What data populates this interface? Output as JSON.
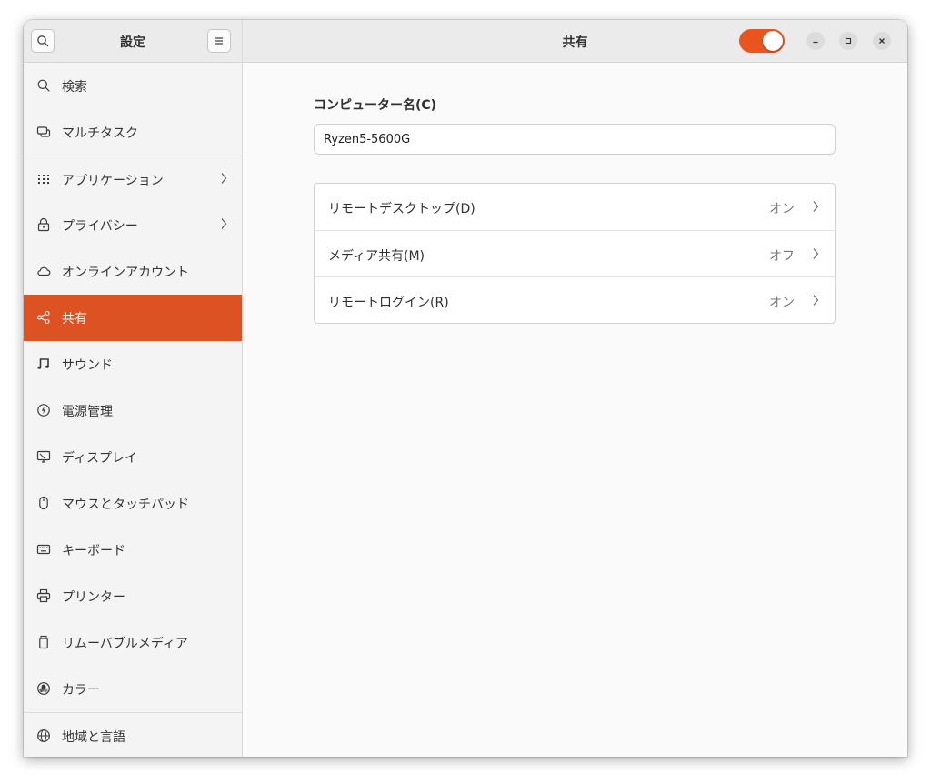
{
  "window": {
    "accent_color": "#e9541f"
  },
  "sidebar": {
    "title": "設定",
    "items": [
      {
        "label": "検索",
        "icon": "search-icon"
      },
      {
        "label": "マルチタスク",
        "icon": "multitasking-icon"
      },
      {
        "label": "アプリケーション",
        "icon": "apps-grid-icon"
      },
      {
        "label": "プライバシー",
        "icon": "lock-icon"
      },
      {
        "label": "オンラインアカウント",
        "icon": "cloud-icon"
      },
      {
        "label": "共有",
        "icon": "share-icon"
      },
      {
        "label": "サウンド",
        "icon": "music-note-icon"
      },
      {
        "label": "電源管理",
        "icon": "power-icon"
      },
      {
        "label": "ディスプレイ",
        "icon": "display-icon"
      },
      {
        "label": "マウスとタッチパッド",
        "icon": "mouse-icon"
      },
      {
        "label": "キーボード",
        "icon": "keyboard-icon"
      },
      {
        "label": "プリンター",
        "icon": "printer-icon"
      },
      {
        "label": "リムーバブルメディア",
        "icon": "removable-media-icon"
      },
      {
        "label": "カラー",
        "icon": "color-icon"
      },
      {
        "label": "地域と言語",
        "icon": "globe-icon"
      }
    ],
    "active_index": 5
  },
  "main": {
    "title": "共有",
    "sharing_enabled": true,
    "computer_name_label": "コンピューター名(C)",
    "computer_name_value": "Ryzen5-5600G",
    "services": [
      {
        "label": "リモートデスクトップ(D)",
        "status": "オン"
      },
      {
        "label": "メディア共有(M)",
        "status": "オフ"
      },
      {
        "label": "リモートログイン(R)",
        "status": "オン"
      }
    ]
  }
}
